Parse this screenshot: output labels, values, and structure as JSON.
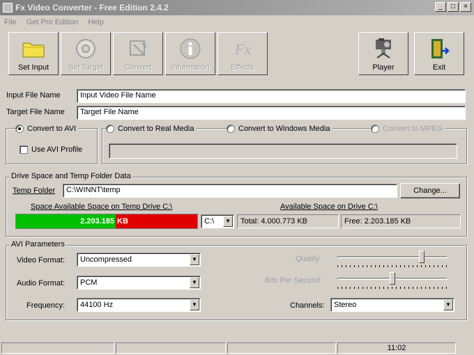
{
  "window": {
    "title": "Fx Video Converter - Free Edition 2.4.2",
    "controls": [
      "_",
      "□",
      "×"
    ]
  },
  "menu": [
    "File",
    "Get Pro Edition",
    "Help"
  ],
  "toolbar": [
    {
      "label": "Set Input",
      "icon": "folder-icon",
      "enabled": true
    },
    {
      "label": "Set Target",
      "icon": "disc-icon",
      "enabled": false
    },
    {
      "label": "Convert",
      "icon": "convert-icon",
      "enabled": false
    },
    {
      "label": "Information",
      "icon": "info-icon",
      "enabled": false
    },
    {
      "label": "Effects",
      "icon": "effects-icon",
      "enabled": false
    },
    {
      "label": "Player",
      "icon": "camera-icon",
      "enabled": true
    },
    {
      "label": "Exit",
      "icon": "exit-door-icon",
      "enabled": true
    }
  ],
  "files": {
    "input_label": "Input File Name",
    "input_value": "Input Video File Name",
    "target_label": "Target File Name",
    "target_value": "Target File Name"
  },
  "convert": {
    "avi": "Convert to AVI",
    "avi_profile": "Use AVI Profile",
    "real": "Convert to Real Media",
    "windows": "Convert to Windows Media",
    "mpeg": "Convert to MPEG"
  },
  "drive": {
    "group_title": "Drive Space and Temp Folder Data",
    "temp_label": "Temp Folder",
    "temp_value": "C:\\WINNT\\temp",
    "change": "Change...",
    "space_temp_label": "Space Available Space on Temp Drive C:\\",
    "space_drive_label": "Available Space on Drive C:\\",
    "used_text": "2.203.185",
    "free_text": "KB",
    "used_fraction": 0.55,
    "drive_letter": "C:\\",
    "total": "Total: 4.000.773 KB",
    "free": "Free: 2.203.185 KB"
  },
  "avi": {
    "group_title": "AVI Parameters",
    "video_label": "Video Format:",
    "video_value": "Uncompressed",
    "audio_label": "Audio Format:",
    "audio_value": "PCM",
    "freq_label": "Frequency:",
    "freq_value": "44100 Hz",
    "quality_label": "Quality",
    "quality_level": 0.78,
    "bits_label": "Bits Per Second:",
    "bits_level": 0.5,
    "channels_label": "Channels:",
    "channels_value": "Stereo"
  },
  "status": {
    "time": "11:02"
  }
}
